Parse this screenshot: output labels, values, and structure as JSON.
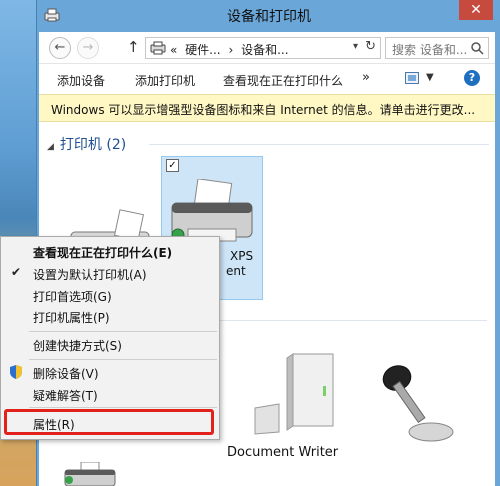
{
  "window": {
    "title": "设备和打印机"
  },
  "nav": {
    "back": "←",
    "forward": "→",
    "up": "↑",
    "crumbs": [
      "«",
      "硬件...",
      "›",
      "设备和..."
    ],
    "dropdown": "▾",
    "refresh": "↻",
    "search_placeholder": "搜索 设备和...",
    "search_icon": "search-icon"
  },
  "toolbar": {
    "add_device": "添加设备",
    "add_printer": "添加打印机",
    "see_printing": "查看现在正在打印什么",
    "more": "»",
    "view_dropdown": "▼",
    "help": "?"
  },
  "infobar": {
    "text": "Windows 可以显示增强型设备图标和来自 Internet 的信息。请单击进行更改..."
  },
  "content": {
    "group_title": "打印机 (2)",
    "group_arrow": "◢",
    "selected_checkbox": "✓",
    "selected_label_1": "XPS",
    "selected_label_2": "ent",
    "document_writer_label": "Document Writer"
  },
  "context_menu": {
    "items": [
      {
        "label": "查看现在正在打印什么(E)",
        "bold": true
      },
      {
        "label": "设置为默认打印机(A)",
        "checked": true
      },
      {
        "label": "打印首选项(G)"
      },
      {
        "label": "打印机属性(P)"
      },
      {
        "label": "创建快捷方式(S)"
      },
      {
        "label": "删除设备(V)",
        "shield": true
      },
      {
        "label": "疑难解答(T)"
      },
      {
        "label": "属性(R)",
        "highlighted": true
      }
    ],
    "check_mark": "✔"
  },
  "colors": {
    "accent_frame": "#6aa7d8",
    "highlight_box": "#e1221b",
    "selected_tile": "#cde5f7",
    "infobar_bg": "#fff8c4",
    "group_title": "#1e4f91"
  }
}
